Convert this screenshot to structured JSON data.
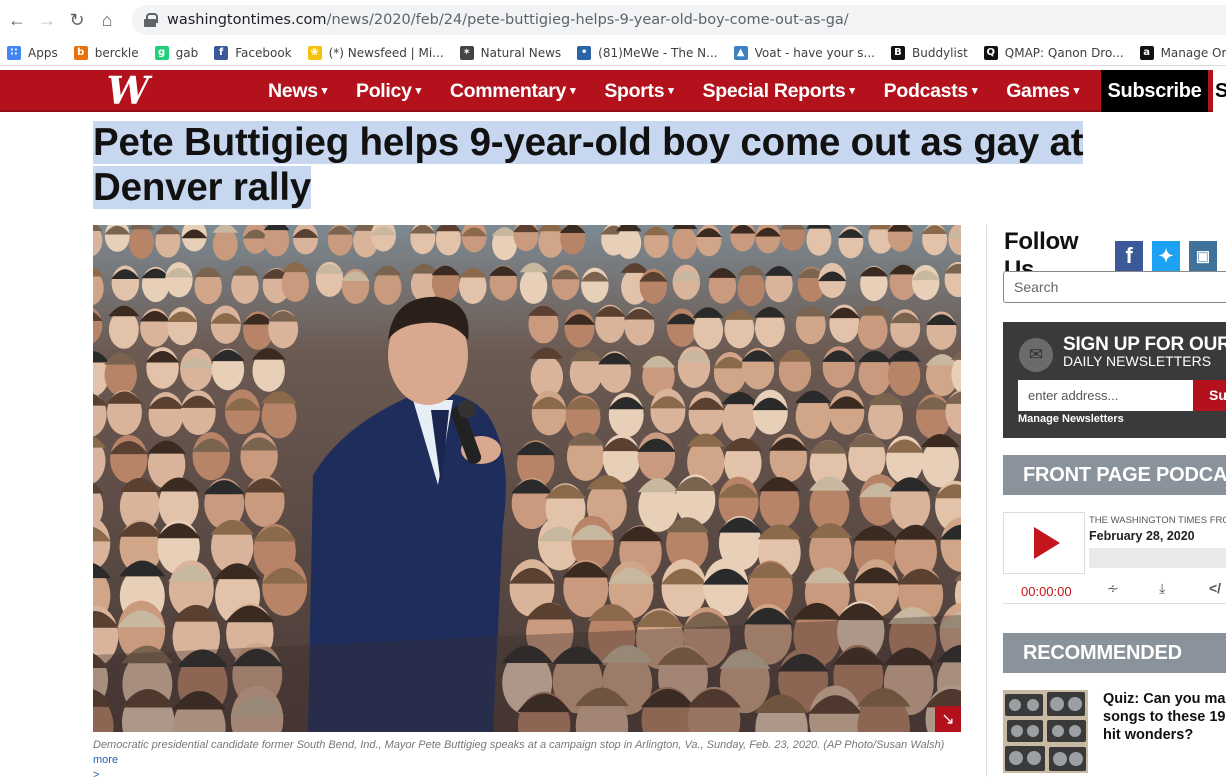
{
  "browser": {
    "url_host": "washingtontimes.com",
    "url_path": "/news/2020/feb/24/pete-buttigieg-helps-9-year-old-boy-come-out-as-ga/",
    "bookmarks": [
      {
        "label": "Apps",
        "icon": "apps-grid-icon",
        "color": "#4285f4"
      },
      {
        "label": "berckle",
        "icon": "berckle-icon",
        "color": "#e8710a"
      },
      {
        "label": "gab",
        "icon": "gab-icon",
        "color": "#21cf7a"
      },
      {
        "label": "Facebook",
        "icon": "facebook-icon",
        "color": "#3b5998"
      },
      {
        "label": "(*) Newsfeed | Mi...",
        "icon": "lightbulb-icon",
        "color": "#f4c20d"
      },
      {
        "label": "Natural News",
        "icon": "natural-news-icon",
        "color": "#444444"
      },
      {
        "label": "(81)MeWe - The N...",
        "icon": "mewe-icon",
        "color": "#2a64a7"
      },
      {
        "label": "Voat - have your s...",
        "icon": "voat-icon",
        "color": "#3b82c4"
      },
      {
        "label": "Buddylist",
        "icon": "buddylist-icon",
        "color": "#111111"
      },
      {
        "label": "QMAP: Qanon Dro...",
        "icon": "qmap-icon",
        "color": "#111111"
      },
      {
        "label": "Manage Or",
        "icon": "amazon-icon",
        "color": "#111111"
      }
    ]
  },
  "site": {
    "logo": "W",
    "nav": [
      "News",
      "Policy",
      "Commentary",
      "Sports",
      "Special Reports",
      "Podcasts",
      "Games"
    ],
    "subscribe_label": "Subscribe",
    "nav_trailing": "S",
    "colors": {
      "brand_red": "#b3121d",
      "link_blue": "#2a5db0",
      "highlight": "#c8d7f0"
    }
  },
  "article": {
    "headline_line1": "Pete Buttigieg helps 9-year-old boy come out as gay at",
    "headline_line2": "Denver rally",
    "caption": "Democratic presidential candidate former South Bend, Ind., Mayor Pete Buttigieg speaks at a campaign stop in Arlington, Va., Sunday, Feb. 23, 2020. (AP Photo/Susan Walsh)",
    "caption_more": "more",
    "caption_more_arrow": ">"
  },
  "sidebar": {
    "follow_title": "Follow Us",
    "search_placeholder": "Search",
    "newsletter": {
      "title_line1": "SIGN UP FOR OUR",
      "title_line2": "DAILY NEWSLETTERS",
      "input_placeholder": "enter address...",
      "submit_label": "Su",
      "manage_label": "Manage Newsletters"
    },
    "podcast": {
      "header": "FRONT PAGE PODCAST",
      "source": "THE WASHINGTON TIMES FRONT PAGE",
      "date": "February 28, 2020",
      "time": "00:00:00",
      "embed_label": "</"
    },
    "recommended": {
      "header": "RECOMMENDED",
      "line1": "Quiz: Can you ma",
      "line2": "songs to these 19",
      "line3": "hit wonders?"
    }
  }
}
